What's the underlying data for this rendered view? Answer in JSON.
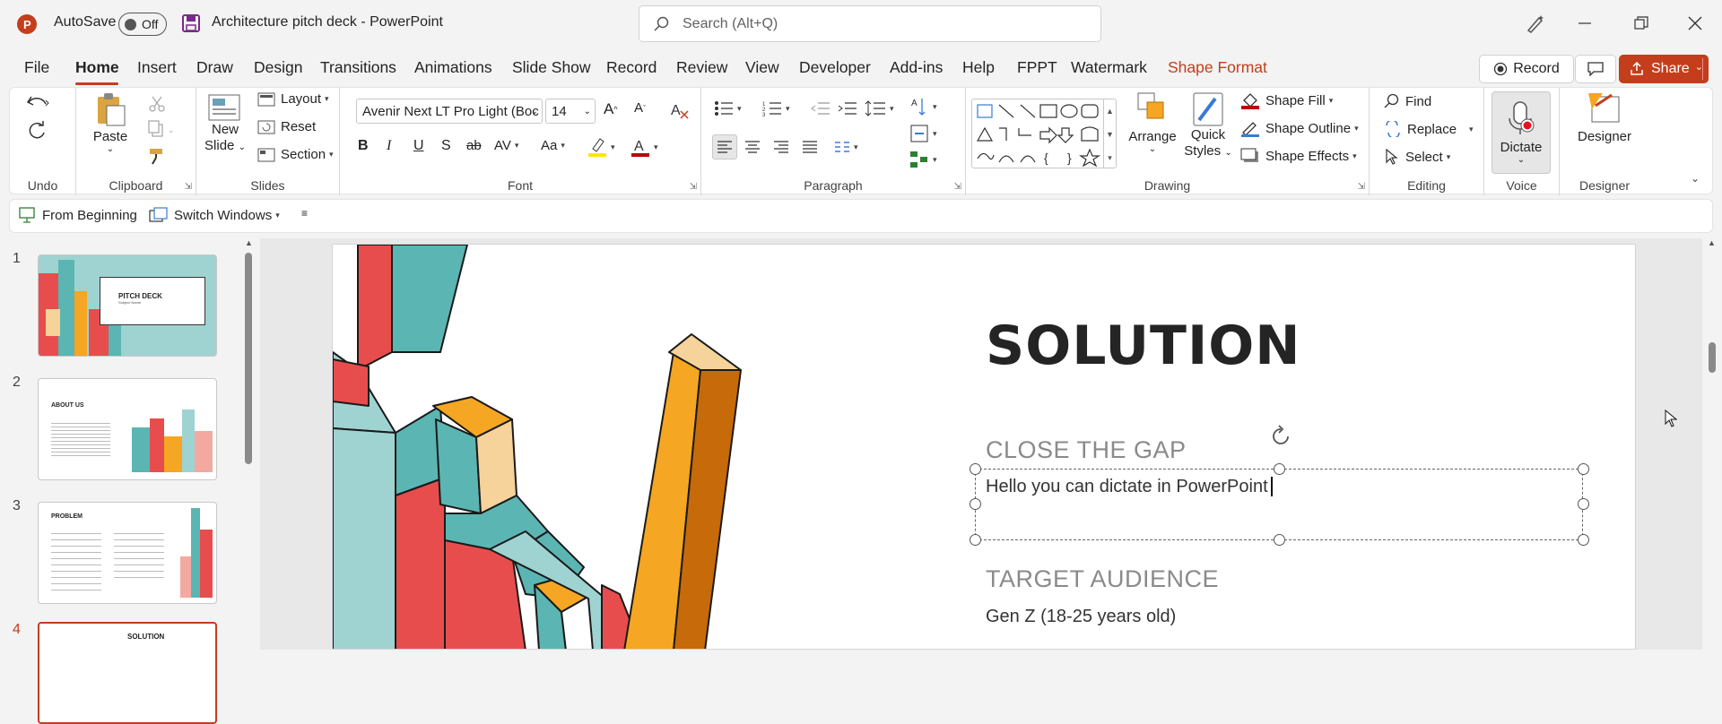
{
  "titlebar": {
    "autosave_label": "AutoSave",
    "autosave_state": "Off",
    "doc_title": "Architecture pitch deck",
    "separator": "-",
    "app_name": "PowerPoint",
    "search_placeholder": "Search (Alt+Q)",
    "accent": "#c43e1c"
  },
  "menu": {
    "tabs": [
      "File",
      "Home",
      "Insert",
      "Draw",
      "Design",
      "Transitions",
      "Animations",
      "Slide Show",
      "Record",
      "Review",
      "View",
      "Developer",
      "Add-ins",
      "Help",
      "FPPT",
      "Watermark",
      "Shape Format"
    ],
    "active": "Home",
    "record_label": "Record",
    "share_label": "Share"
  },
  "ribbon": {
    "undo_group": "Undo",
    "clipboard": {
      "paste": "Paste",
      "label": "Clipboard"
    },
    "slides": {
      "new_slide_1": "New",
      "new_slide_2": "Slide",
      "layout": "Layout",
      "reset": "Reset",
      "section": "Section",
      "label": "Slides"
    },
    "font": {
      "family": "Avenir Next LT Pro Light (Boc",
      "size": "14",
      "label": "Font"
    },
    "paragraph": {
      "label": "Paragraph"
    },
    "drawing": {
      "arrange": "Arrange",
      "quick_styles_1": "Quick",
      "quick_styles_2": "Styles",
      "shape_fill": "Shape Fill",
      "shape_outline": "Shape Outline",
      "shape_effects": "Shape Effects",
      "label": "Drawing"
    },
    "editing": {
      "find": "Find",
      "replace": "Replace",
      "select": "Select",
      "label": "Editing"
    },
    "voice": {
      "dictate": "Dictate",
      "label": "Voice"
    },
    "designer": {
      "designer": "Designer",
      "label": "Designer"
    }
  },
  "qat": {
    "from_beginning": "From Beginning",
    "switch_windows": "Switch Windows"
  },
  "thumbnails": [
    {
      "num": "1",
      "title": "PITCH DECK",
      "subtitle": "Subject Name"
    },
    {
      "num": "2",
      "title": "ABOUT US"
    },
    {
      "num": "3",
      "title": "PROBLEM"
    },
    {
      "num": "4",
      "title": "SOLUTION",
      "selected": true
    }
  ],
  "slide": {
    "title": "SOLUTION",
    "heading1": "CLOSE THE GAP",
    "body1": "Hello you can dictate in PowerPoint",
    "heading2": "TARGET AUDIENCE",
    "body2": "Gen Z (18-25 years old)"
  }
}
